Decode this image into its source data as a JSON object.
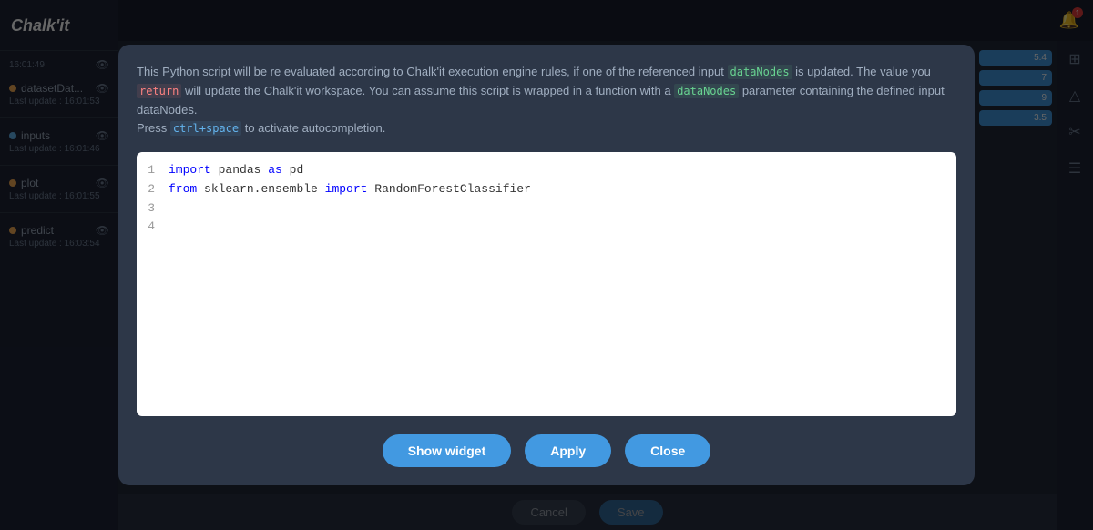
{
  "app": {
    "name": "Chalk'it",
    "logo": "Chalk'it"
  },
  "topbar": {
    "bell_badge": "1"
  },
  "sidebar": {
    "items": [
      {
        "id": "datasetDat",
        "label": "datasetDat...",
        "dot_color": "orange",
        "last_update_label": "Last update :",
        "timestamp": "16:01:53"
      },
      {
        "id": "inputs",
        "label": "inputs",
        "dot_color": "blue",
        "last_update_label": "Last update :",
        "timestamp": "16:01:46"
      },
      {
        "id": "plot",
        "label": "plot",
        "dot_color": "orange",
        "last_update_label": "Last update :",
        "timestamp": "16:01:55"
      },
      {
        "id": "predict",
        "label": "predict",
        "dot_color": "orange",
        "last_update_label": "Last update :",
        "timestamp": "16:03:54"
      }
    ],
    "topbar_time": "16:01:49"
  },
  "modal": {
    "description_parts": {
      "intro": "This Python script will be re evaluated according to Chalk'it execution engine rules, if one of the referenced input",
      "dataNodes_1": "dataNodes",
      "mid1": "is updated. The value you",
      "return": "return",
      "mid2": "will update the Chalk'it workspace. You can assume this script is wrapped in a function with a",
      "dataNodes_2": "dataNodes",
      "mid3": "parameter containing the defined input dataNodes.",
      "press": "Press",
      "ctrl_space": "ctrl+space",
      "activate": "to activate autocompletion."
    },
    "code": {
      "lines": [
        {
          "number": "1",
          "content": "import pandas as pd"
        },
        {
          "number": "2",
          "content": "from sklearn.ensemble import RandomForestClassifier"
        },
        {
          "number": "3",
          "content": ""
        },
        {
          "number": "4",
          "content": ""
        }
      ]
    },
    "buttons": {
      "show_widget": "Show widget",
      "apply": "Apply",
      "close": "Close"
    }
  },
  "bottom_bar": {
    "cancel": "Cancel",
    "save": "Save"
  },
  "right_panel": {
    "chips": [
      "5.4",
      "7",
      "9",
      "3.5"
    ]
  }
}
